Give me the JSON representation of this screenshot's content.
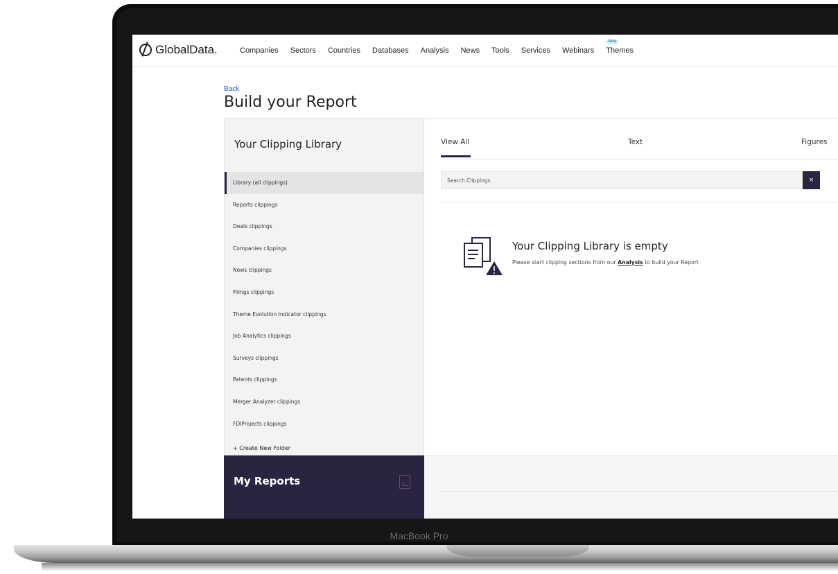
{
  "device": {
    "label": "MacBook Pro"
  },
  "nav": {
    "logo": "GlobalData.",
    "links": [
      "Companies",
      "Sectors",
      "Countries",
      "Databases",
      "Analysis",
      "News",
      "Tools",
      "Services",
      "Webinars",
      "Themes"
    ],
    "new_badge": "New"
  },
  "header": {
    "back": "Back",
    "title": "Build your Report"
  },
  "library": {
    "title": "Your Clipping Library",
    "items": [
      "Library (all clippings)",
      "Reports clippings",
      "Deals clippings",
      "Companies clippings",
      "News clippings",
      "Filings clippings",
      "Theme Evolution Indicator clippings",
      "Job Analytics clippings",
      "Surveys clippings",
      "Patents clippings",
      "Merger Analyzer clippings",
      "FDIProjects clippings"
    ],
    "create_folder": "+ Create New Folder"
  },
  "reports": {
    "title": "My Reports"
  },
  "tabs": [
    "View All",
    "Text",
    "Figures"
  ],
  "search": {
    "placeholder": "Search Clippings",
    "clear_label": "×"
  },
  "empty": {
    "title": "Your Clipping Library is empty",
    "text_before": "Please start clipping sections from our ",
    "link": "Analysis",
    "text_after": " to build your Report"
  },
  "colors": {
    "accent": "#2b2440",
    "link": "#1e5ab8",
    "panel": "#f3f3f3"
  }
}
